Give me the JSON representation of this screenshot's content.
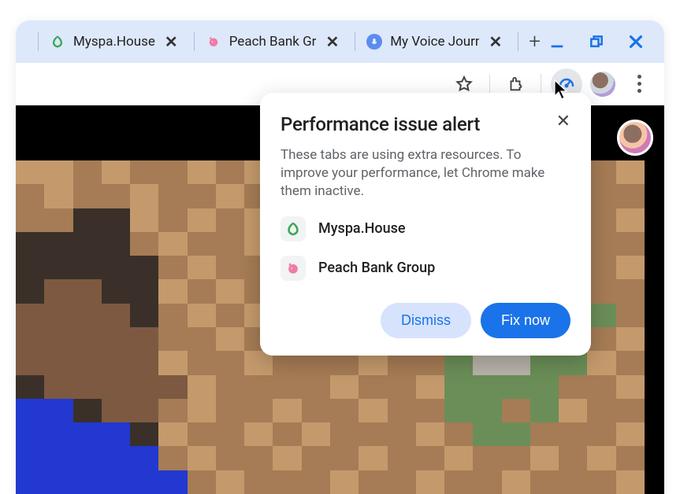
{
  "tabs": [
    {
      "label": "Myspa.House",
      "icon_name": "leaf-icon",
      "icon_bg": "#ffffff",
      "icon_glyph": "❇"
    },
    {
      "label": "Peach Bank Gr",
      "icon_name": "piggy-icon",
      "icon_bg": "#ffffff",
      "icon_glyph": "🐷"
    },
    {
      "label": "My Voice Journ",
      "icon_name": "mic-icon",
      "icon_bg": "#5b8def",
      "icon_glyph": "●"
    }
  ],
  "popup": {
    "title": "Performance issue alert",
    "description": "These tabs are using extra resources. To improve your performance, let Chrome make them inactive.",
    "sites": [
      {
        "name": "Myspa.House",
        "icon_name": "leaf-icon",
        "icon_glyph": "❇"
      },
      {
        "name": "Peach Bank Group",
        "icon_name": "piggy-icon",
        "icon_glyph": "🐷"
      }
    ],
    "dismiss_label": "Dismiss",
    "fix_label": "Fix now"
  }
}
